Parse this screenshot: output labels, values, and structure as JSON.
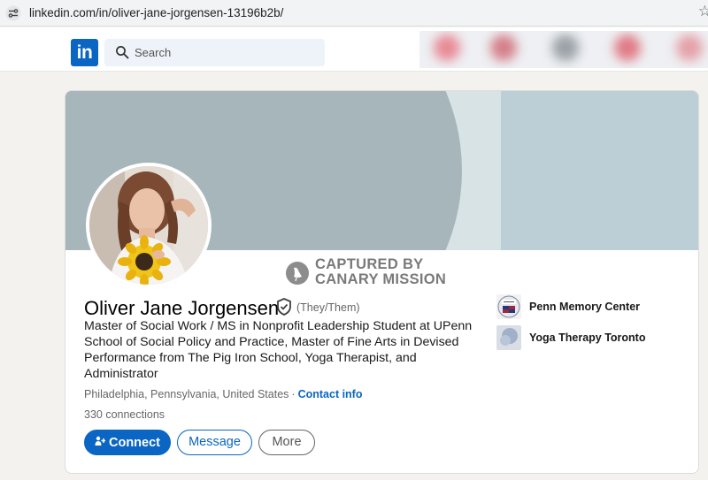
{
  "browser": {
    "url": "linkedin.com/in/oliver-jane-jorgensen-13196b2b/"
  },
  "nav": {
    "logo_text": "in",
    "search_placeholder": "Search"
  },
  "profile": {
    "watermark_line1": "CAPTURED BY",
    "watermark_line2": "CANARY MISSION",
    "name": "Oliver Jane Jorgensen",
    "pronouns": "(They/Them)",
    "headline": "Master of Social Work / MS in Nonprofit Leadership Student at UPenn School of Social Policy and Practice, Master of Fine Arts in Devised Performance from The Pig Iron School, Yoga Therapist, and Administrator",
    "location": "Philadelphia, Pennsylvania, United States",
    "location_separator": "·",
    "contact_info": "Contact info",
    "connections": "330 connections"
  },
  "actions": {
    "connect_label": "Connect",
    "message_label": "Message",
    "more_label": "More"
  },
  "organizations": [
    {
      "name": "Penn Memory Center",
      "logo_text": "Penn Memory Center"
    },
    {
      "name": "Yoga Therapy Toronto"
    }
  ],
  "colors": {
    "linkedin_blue": "#0a66c2",
    "banner": "#bfcfd6",
    "banner_arc": "#a7b6bb"
  }
}
